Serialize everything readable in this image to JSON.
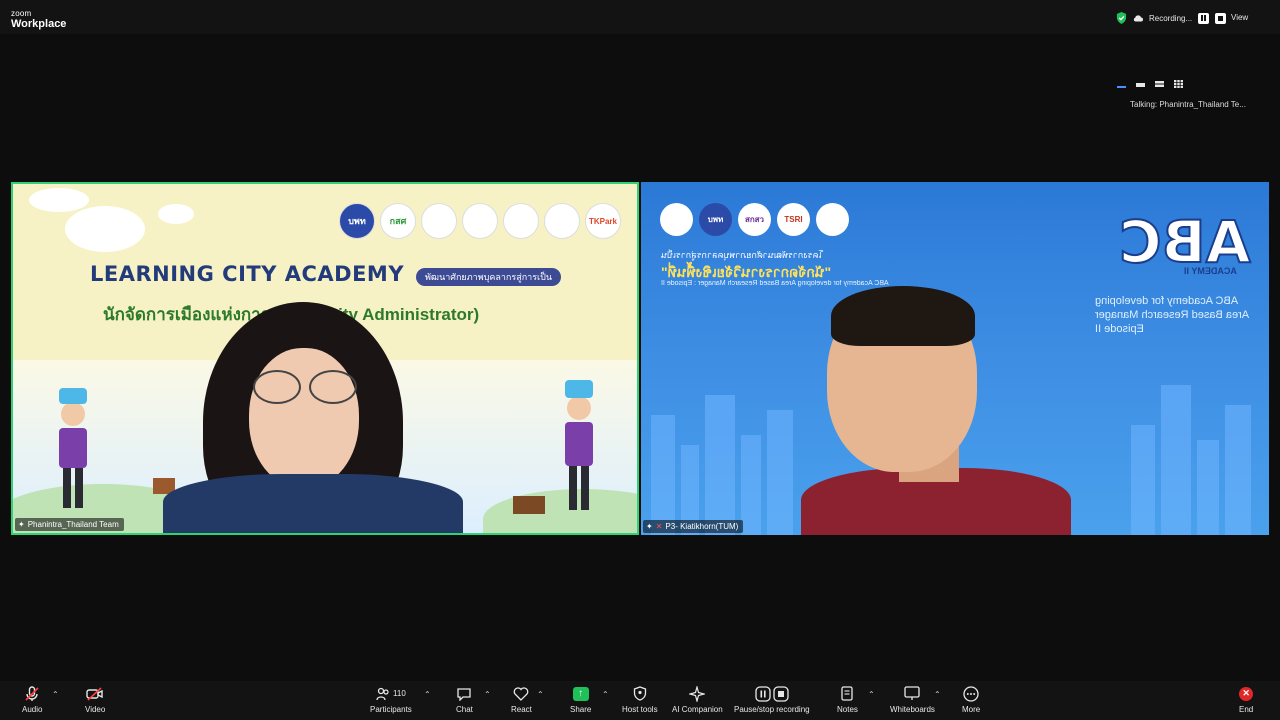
{
  "app": {
    "brand_small": "zoom",
    "brand_big": "Workplace"
  },
  "topbar": {
    "recording_label": "Recording...",
    "view_label": "View"
  },
  "talking": "Talking:  Phanintra_Thailand  Te...",
  "tiles": [
    {
      "name": "Phanintra_Thailand Team",
      "headline": "LEARNING CITY ACADEMY",
      "pill": "พัฒนาศักยภาพบุคลากรสู่การเป็น",
      "thai_title": "นักจัดการเมืองแห่งการเรียนรู้ (City Administrator)",
      "logos": [
        "บพท",
        "กสศ",
        "",
        "",
        "",
        "",
        "TKPark"
      ]
    },
    {
      "name": "P3- Kiatikhorn(TUM)",
      "logos": [
        "",
        "บพท",
        "สกสว",
        "TSRI",
        ""
      ],
      "abc_logo": "ABC",
      "abc_sub": "ACADEMY II",
      "abc_desc": "ABC Academy for developing\nArea Based Research Manager\nEpisode II",
      "thai_line1": "โครงการพัฒนาศักยภาพบุคลากรสู่การเป็น",
      "thai_line2": "\"นักจัดการงานวิจัยเชิงพื้นที่\"",
      "thai_line3": "ABC Academy for developing Area Based Research Manager : Episode II"
    }
  ],
  "toolbar": {
    "audio": "Audio",
    "video": "Video",
    "participants": "Participants",
    "participants_count": "110",
    "chat": "Chat",
    "react": "React",
    "share": "Share",
    "host_tools": "Host tools",
    "ai_companion": "AI Companion",
    "pause_recording": "Pause/stop recording",
    "notes": "Notes",
    "whiteboards": "Whiteboards",
    "more": "More",
    "end": "End"
  },
  "colors": {
    "active_speaker_border": "#2fd276",
    "recording_shield": "#21c15a",
    "end_red": "#e02828",
    "share_green": "#21c15a"
  },
  "icons": [
    "mic-muted-icon",
    "video-off-icon",
    "participants-icon",
    "chat-icon",
    "react-icon",
    "share-icon",
    "host-tools-icon",
    "ai-companion-icon",
    "pause-record-icon",
    "notes-icon",
    "whiteboard-icon",
    "more-icon",
    "end-icon"
  ]
}
